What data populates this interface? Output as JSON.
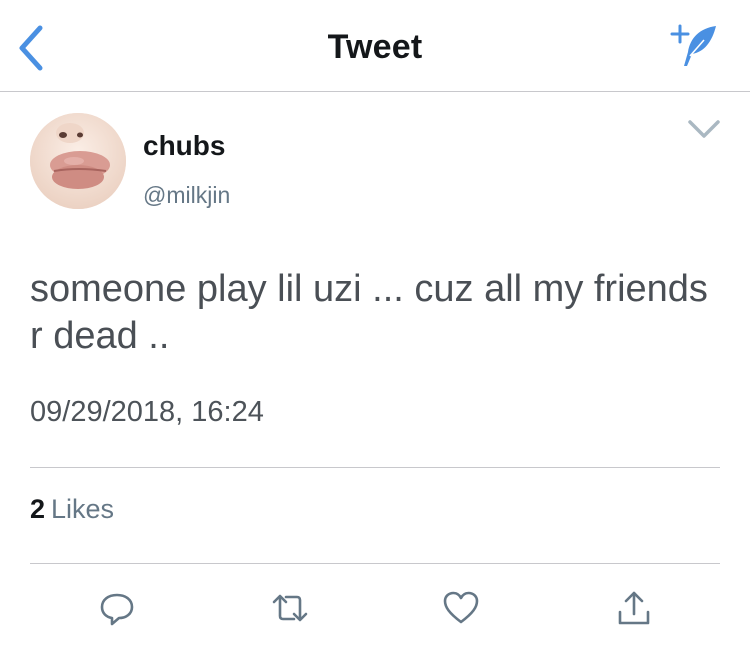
{
  "nav": {
    "title": "Tweet",
    "back_icon": "chevron-left-icon",
    "compose_icon": "compose-tweet-icon",
    "accent_color": "#4a90e2"
  },
  "tweet": {
    "author": {
      "display_name": "chubs",
      "handle": "@milkjin",
      "avatar_icon": "profile-photo"
    },
    "text": "someone play lil uzi ... cuz all my friends r dead ..",
    "timestamp": "09/29/2018, 16:24",
    "likes": {
      "count": "2",
      "label": "Likes"
    },
    "actions": [
      "reply-icon",
      "retweet-icon",
      "like-icon",
      "share-icon"
    ],
    "action_color": "#657786"
  }
}
